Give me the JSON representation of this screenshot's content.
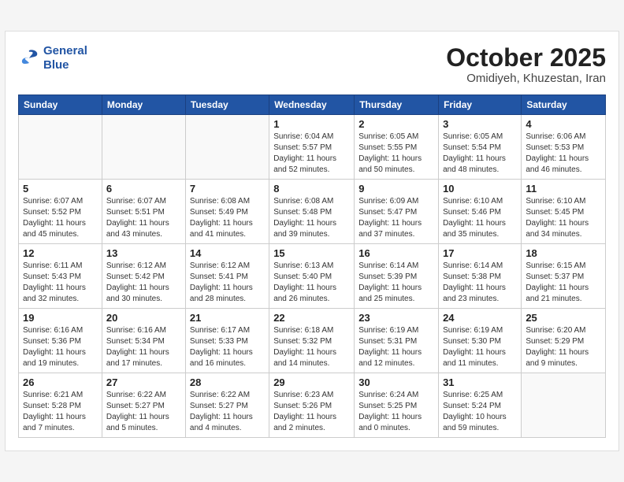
{
  "header": {
    "logo_line1": "General",
    "logo_line2": "Blue",
    "month": "October 2025",
    "location": "Omidiyeh, Khuzestan, Iran"
  },
  "weekdays": [
    "Sunday",
    "Monday",
    "Tuesday",
    "Wednesday",
    "Thursday",
    "Friday",
    "Saturday"
  ],
  "weeks": [
    [
      {
        "day": "",
        "info": ""
      },
      {
        "day": "",
        "info": ""
      },
      {
        "day": "",
        "info": ""
      },
      {
        "day": "1",
        "info": "Sunrise: 6:04 AM\nSunset: 5:57 PM\nDaylight: 11 hours and 52 minutes."
      },
      {
        "day": "2",
        "info": "Sunrise: 6:05 AM\nSunset: 5:55 PM\nDaylight: 11 hours and 50 minutes."
      },
      {
        "day": "3",
        "info": "Sunrise: 6:05 AM\nSunset: 5:54 PM\nDaylight: 11 hours and 48 minutes."
      },
      {
        "day": "4",
        "info": "Sunrise: 6:06 AM\nSunset: 5:53 PM\nDaylight: 11 hours and 46 minutes."
      }
    ],
    [
      {
        "day": "5",
        "info": "Sunrise: 6:07 AM\nSunset: 5:52 PM\nDaylight: 11 hours and 45 minutes."
      },
      {
        "day": "6",
        "info": "Sunrise: 6:07 AM\nSunset: 5:51 PM\nDaylight: 11 hours and 43 minutes."
      },
      {
        "day": "7",
        "info": "Sunrise: 6:08 AM\nSunset: 5:49 PM\nDaylight: 11 hours and 41 minutes."
      },
      {
        "day": "8",
        "info": "Sunrise: 6:08 AM\nSunset: 5:48 PM\nDaylight: 11 hours and 39 minutes."
      },
      {
        "day": "9",
        "info": "Sunrise: 6:09 AM\nSunset: 5:47 PM\nDaylight: 11 hours and 37 minutes."
      },
      {
        "day": "10",
        "info": "Sunrise: 6:10 AM\nSunset: 5:46 PM\nDaylight: 11 hours and 35 minutes."
      },
      {
        "day": "11",
        "info": "Sunrise: 6:10 AM\nSunset: 5:45 PM\nDaylight: 11 hours and 34 minutes."
      }
    ],
    [
      {
        "day": "12",
        "info": "Sunrise: 6:11 AM\nSunset: 5:43 PM\nDaylight: 11 hours and 32 minutes."
      },
      {
        "day": "13",
        "info": "Sunrise: 6:12 AM\nSunset: 5:42 PM\nDaylight: 11 hours and 30 minutes."
      },
      {
        "day": "14",
        "info": "Sunrise: 6:12 AM\nSunset: 5:41 PM\nDaylight: 11 hours and 28 minutes."
      },
      {
        "day": "15",
        "info": "Sunrise: 6:13 AM\nSunset: 5:40 PM\nDaylight: 11 hours and 26 minutes."
      },
      {
        "day": "16",
        "info": "Sunrise: 6:14 AM\nSunset: 5:39 PM\nDaylight: 11 hours and 25 minutes."
      },
      {
        "day": "17",
        "info": "Sunrise: 6:14 AM\nSunset: 5:38 PM\nDaylight: 11 hours and 23 minutes."
      },
      {
        "day": "18",
        "info": "Sunrise: 6:15 AM\nSunset: 5:37 PM\nDaylight: 11 hours and 21 minutes."
      }
    ],
    [
      {
        "day": "19",
        "info": "Sunrise: 6:16 AM\nSunset: 5:36 PM\nDaylight: 11 hours and 19 minutes."
      },
      {
        "day": "20",
        "info": "Sunrise: 6:16 AM\nSunset: 5:34 PM\nDaylight: 11 hours and 17 minutes."
      },
      {
        "day": "21",
        "info": "Sunrise: 6:17 AM\nSunset: 5:33 PM\nDaylight: 11 hours and 16 minutes."
      },
      {
        "day": "22",
        "info": "Sunrise: 6:18 AM\nSunset: 5:32 PM\nDaylight: 11 hours and 14 minutes."
      },
      {
        "day": "23",
        "info": "Sunrise: 6:19 AM\nSunset: 5:31 PM\nDaylight: 11 hours and 12 minutes."
      },
      {
        "day": "24",
        "info": "Sunrise: 6:19 AM\nSunset: 5:30 PM\nDaylight: 11 hours and 11 minutes."
      },
      {
        "day": "25",
        "info": "Sunrise: 6:20 AM\nSunset: 5:29 PM\nDaylight: 11 hours and 9 minutes."
      }
    ],
    [
      {
        "day": "26",
        "info": "Sunrise: 6:21 AM\nSunset: 5:28 PM\nDaylight: 11 hours and 7 minutes."
      },
      {
        "day": "27",
        "info": "Sunrise: 6:22 AM\nSunset: 5:27 PM\nDaylight: 11 hours and 5 minutes."
      },
      {
        "day": "28",
        "info": "Sunrise: 6:22 AM\nSunset: 5:27 PM\nDaylight: 11 hours and 4 minutes."
      },
      {
        "day": "29",
        "info": "Sunrise: 6:23 AM\nSunset: 5:26 PM\nDaylight: 11 hours and 2 minutes."
      },
      {
        "day": "30",
        "info": "Sunrise: 6:24 AM\nSunset: 5:25 PM\nDaylight: 11 hours and 0 minutes."
      },
      {
        "day": "31",
        "info": "Sunrise: 6:25 AM\nSunset: 5:24 PM\nDaylight: 10 hours and 59 minutes."
      },
      {
        "day": "",
        "info": ""
      }
    ]
  ]
}
